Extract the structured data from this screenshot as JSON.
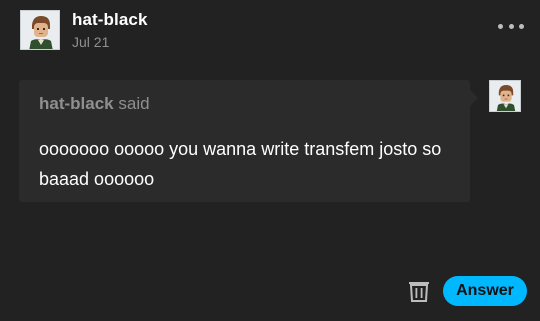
{
  "post": {
    "author": "hat-black",
    "date": "Jul 21",
    "avatar_icon": "pixel-portrait-avatar",
    "more_icon": "more-options-icon"
  },
  "ask": {
    "asker": "hat-black",
    "said_label": "said",
    "body": "ooooooo ooooo you wanna write transfem josto so baaad oooooo",
    "avatar_icon": "pixel-portrait-avatar"
  },
  "actions": {
    "delete_icon": "trash-icon",
    "answer_label": "Answer"
  },
  "colors": {
    "background": "#222222",
    "card": "#2b2b2b",
    "accent": "#00b8ff",
    "muted": "#8f8f8f"
  }
}
